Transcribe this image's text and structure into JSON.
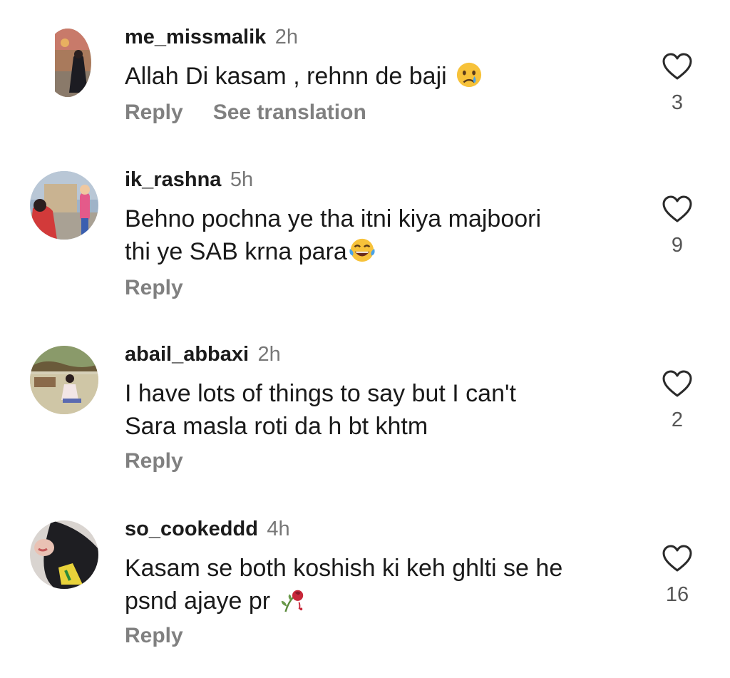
{
  "comments": [
    {
      "username": "me_missmalik",
      "time": "2h",
      "lines": [
        "Allah Di kasam , rehnn de baji"
      ],
      "reply_label": "Reply",
      "translate_label": "See translation",
      "likes": "3",
      "avatar_icon": "profile-photo",
      "emoji_icon": "crying-face-emoji"
    },
    {
      "username": "ik_rashna",
      "time": "5h",
      "lines": [
        "Behno pochna ye tha itni kiya majboori",
        "thi ye SAB krna para"
      ],
      "reply_label": "Reply",
      "likes": "9",
      "avatar_icon": "profile-photo",
      "emoji_icon": "tears-of-joy-emoji"
    },
    {
      "username": "abail_abbaxi",
      "time": "2h",
      "lines": [
        "I have lots of things to say but I can't",
        "Sara masla roti da h bt khtm"
      ],
      "reply_label": "Reply",
      "likes": "2",
      "avatar_icon": "profile-photo"
    },
    {
      "username": "so_cookeddd",
      "time": "4h",
      "lines": [
        "Kasam se both koshish ki keh ghlti se he",
        "psnd ajaye pr"
      ],
      "reply_label": "Reply",
      "likes": "16",
      "avatar_icon": "profile-photo",
      "emoji_icon": "wilted-rose-emoji"
    }
  ],
  "colors": {
    "username": "#1b1b1b",
    "meta": "#808080",
    "text": "#1a1a1a",
    "heart_stroke": "#2a2a2a"
  }
}
